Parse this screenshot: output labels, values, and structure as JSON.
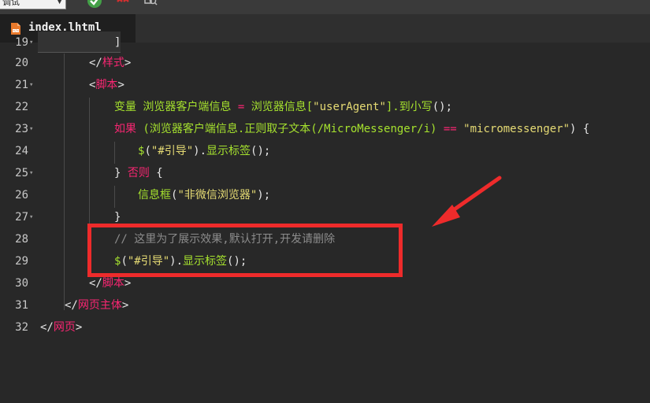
{
  "toolbar": {
    "mode_label": "调试",
    "colors": {
      "run": "#4caf50",
      "stop": "#e53935",
      "search": "#9e9e9e"
    },
    "icons": [
      "run-icon",
      "stop-icon",
      "search-icon"
    ]
  },
  "tab": {
    "title": "index.lhtml",
    "icon": "html-file-icon"
  },
  "editor": {
    "line_numbers": [
      "19",
      "20",
      "21",
      "22",
      "23",
      "24",
      "25",
      "26",
      "27",
      "28",
      "29",
      "30",
      "31",
      "32"
    ],
    "lines": {
      "l20": {
        "open": "</",
        "name": "样式",
        "close": ">"
      },
      "l21": {
        "open": "<",
        "name": "脚本",
        "close": ">"
      },
      "l22": {
        "kw": "变量",
        "v1": " 浏览器客户端信息 ",
        "eq": "=",
        "v2": " 浏览器信息[",
        "s1": "\"userAgent\"",
        "v3": "].",
        "fn": "到小写",
        "end": "();"
      },
      "l23": {
        "kw": "如果",
        "v1": " (浏览器客户端信息.",
        "fn": "正则取子文本",
        "v2": "(/MicroMessenger/i) ",
        "eq": "==",
        "v3": " ",
        "s1": "\"micromessenger\"",
        "end": ") {"
      },
      "l24": {
        "fn1": "$",
        "p1": "(",
        "s1": "\"#引导\"",
        "p2": ").",
        "fn2": "显示标签",
        "end": "();"
      },
      "l25": {
        "p1": "} ",
        "kw": "否则",
        "p2": " {"
      },
      "l26": {
        "fn": "信息框",
        "p1": "(",
        "s1": "\"非微信浏览器\"",
        "end": ");"
      },
      "l27": {
        "p1": "}"
      },
      "l28": {
        "comment": "// 这里为了展示效果,默认打开,开发请删除"
      },
      "l29": {
        "fn1": "$",
        "p1": "(",
        "s1": "\"#引导\"",
        "p2": ").",
        "fn2": "显示标签",
        "end": "();"
      },
      "l30": {
        "open": "</",
        "name": "脚本",
        "close": ">"
      },
      "l31": {
        "open": "</",
        "name": "网页主体",
        "close": ">"
      },
      "l32": {
        "open": "</",
        "name": "网页",
        "close": ">"
      }
    }
  },
  "annotation": {
    "color": "#ee2b2b"
  }
}
